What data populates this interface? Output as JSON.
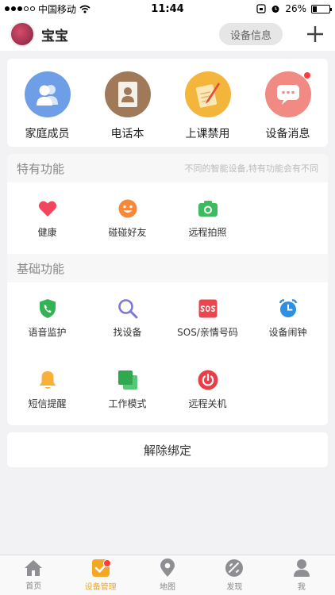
{
  "status_bar": {
    "carrier": "中国移动",
    "time": "11:44",
    "battery": "26%"
  },
  "header": {
    "title": "宝宝",
    "device_info_label": "设备信息"
  },
  "top_actions": [
    {
      "label": "家庭成员",
      "icon": "family-members-icon"
    },
    {
      "label": "电话本",
      "icon": "phonebook-icon"
    },
    {
      "label": "上课禁用",
      "icon": "class-disable-icon"
    },
    {
      "label": "设备消息",
      "icon": "device-message-icon"
    }
  ],
  "special": {
    "title": "特有功能",
    "subtitle": "不同的智能设备,特有功能会有不同",
    "items": [
      {
        "label": "健康",
        "icon": "heart-icon"
      },
      {
        "label": "碰碰好友",
        "icon": "smile-icon"
      },
      {
        "label": "远程拍照",
        "icon": "camera-icon"
      }
    ]
  },
  "basic": {
    "title": "基础功能",
    "items": [
      {
        "label": "语音监护",
        "icon": "shield-phone-icon"
      },
      {
        "label": "找设备",
        "icon": "search-icon"
      },
      {
        "label": "SOS/亲情号码",
        "icon": "sos-icon"
      },
      {
        "label": "设备闹钟",
        "icon": "alarm-clock-icon"
      },
      {
        "label": "短信提醒",
        "icon": "bell-icon"
      },
      {
        "label": "工作模式",
        "icon": "work-mode-icon"
      },
      {
        "label": "远程关机",
        "icon": "power-icon"
      }
    ]
  },
  "unbind_label": "解除绑定",
  "tabs": [
    {
      "label": "首页",
      "icon": "home-icon"
    },
    {
      "label": "设备管理",
      "icon": "device-manage-icon"
    },
    {
      "label": "地图",
      "icon": "map-pin-icon"
    },
    {
      "label": "发现",
      "icon": "discover-icon"
    },
    {
      "label": "我",
      "icon": "person-icon"
    }
  ],
  "colors": {
    "accent": "#f5a623",
    "badge": "#ff3b3b"
  }
}
